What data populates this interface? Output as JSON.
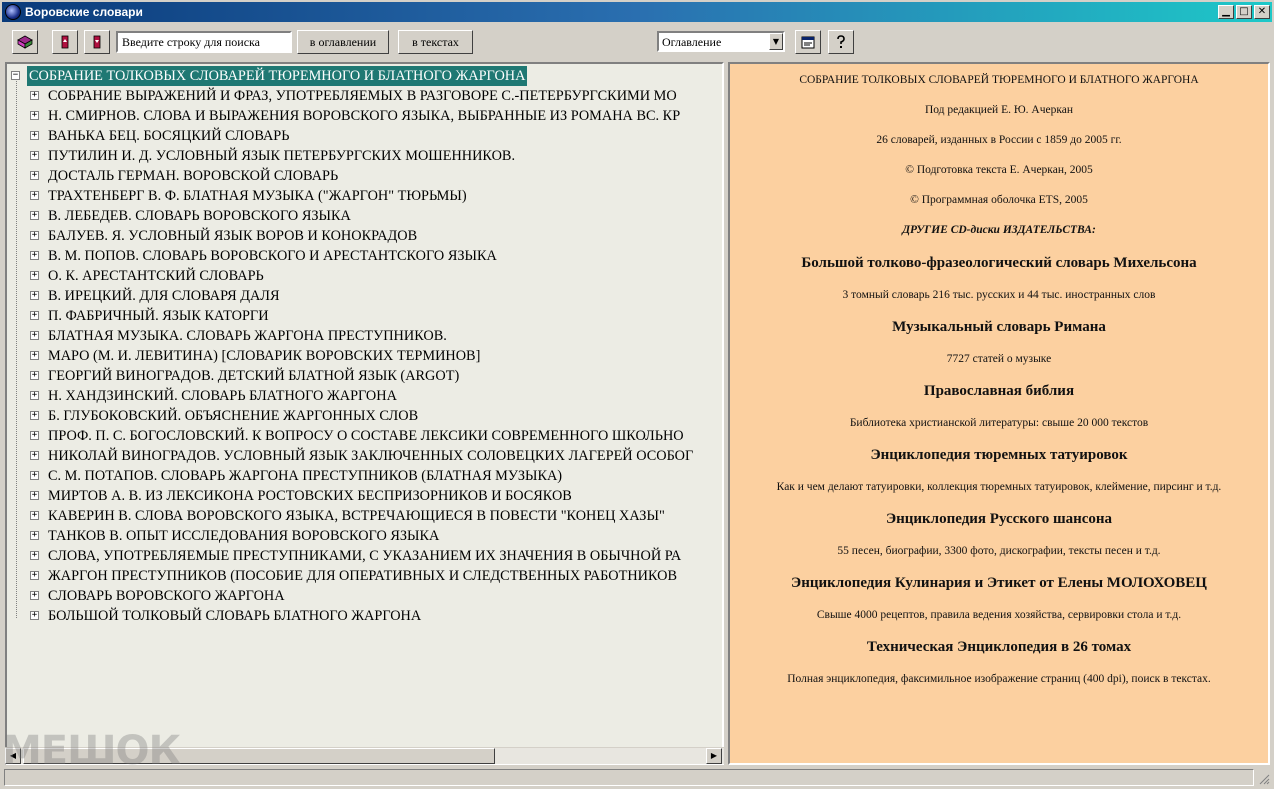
{
  "window": {
    "title": "Воровские словари"
  },
  "toolbar": {
    "search_placeholder": "Введите строку для поиска",
    "btn_in_contents": "в оглавлении",
    "btn_in_texts": "в текстах",
    "select_value": "Оглавление"
  },
  "tree": {
    "root": "СОБРАНИЕ ТОЛКОВЫХ СЛОВАРЕЙ ТЮРЕМНОГО И БЛАТНОГО ЖАРГОНА",
    "items": [
      "СОБРАНИЕ ВЫРАЖЕНИЙ И ФРАЗ, УПОТРЕБЛЯЕМЫХ В РАЗГОВОРЕ С.-ПЕТЕРБУРГСКИМИ МО",
      "Н. СМИРНОВ. СЛОВА И ВЫРАЖЕНИЯ ВОРОВСКОГО ЯЗЫКА, ВЫБРАННЫЕ ИЗ РОМАНА ВС. КР",
      "ВАНЬКА БЕЦ. БОСЯЦКИЙ СЛОВАРЬ",
      "ПУТИЛИН И. Д. УСЛОВНЫЙ ЯЗЫК ПЕТЕРБУРГСКИХ МОШЕННИКОВ.",
      "ДОСТАЛЬ ГЕРМАН. ВОРОВСКОЙ СЛОВАРЬ",
      "ТРАХТЕНБЕРГ В. Ф. БЛАТНАЯ МУЗЫКА (\"ЖАРГОН\" ТЮРЬМЫ)",
      "В. ЛЕБЕДЕВ. СЛОВАРЬ ВОРОВСКОГО ЯЗЫКА",
      "БАЛУЕВ. Я. УСЛОВНЫЙ ЯЗЫК ВОРОВ И КОНОКРАДОВ",
      "В. М. ПОПОВ. СЛОВАРЬ ВОРОВСКОГО И АРЕСТАНТСКОГО ЯЗЫКА",
      "О. К. АРЕСТАНТСКИЙ СЛОВАРЬ",
      "В. ИРЕЦКИЙ. ДЛЯ СЛОВАРЯ ДАЛЯ",
      "П. ФАБРИЧНЫЙ. ЯЗЫК КАТОРГИ",
      "БЛАТНАЯ МУЗЫКА. СЛОВАРЬ ЖАРГОНА ПРЕСТУПНИКОВ.",
      "МАРО (М. И. ЛЕВИТИНА) [СЛОВАРИК ВОРОВСКИХ ТЕРМИНОВ]",
      "ГЕОРГИЙ ВИНОГРАДОВ. ДЕТСКИЙ БЛАТНОЙ ЯЗЫК (ARGOT)",
      "Н. ХАНДЗИНСКИЙ. СЛОВАРЬ БЛАТНОГО ЖАРГОНА",
      "Б. ГЛУБОКОВСКИЙ. ОБЪЯСНЕНИЕ ЖАРГОННЫХ СЛОВ",
      "ПРОФ. П. С. БОГОСЛОВСКИЙ. К ВОПРОСУ О СОСТАВЕ ЛЕКСИКИ СОВРЕМЕННОГО ШКОЛЬНО",
      "НИКОЛАЙ ВИНОГРАДОВ. УСЛОВНЫЙ ЯЗЫК ЗАКЛЮЧЕННЫХ СОЛОВЕЦКИХ ЛАГЕРЕЙ ОСОБОГ",
      "С. М. ПОТАПОВ. СЛОВАРЬ ЖАРГОНА ПРЕСТУПНИКОВ (БЛАТНАЯ МУЗЫКА)",
      "МИРТОВ А. В. ИЗ ЛЕКСИКОНА РОСТОВСКИХ БЕСПРИЗОРНИКОВ И БОСЯКОВ",
      "КАВЕРИН В. СЛОВА ВОРОВСКОГО ЯЗЫКА, ВСТРЕЧАЮЩИЕСЯ В ПОВЕСТИ \"КОНЕЦ ХАЗЫ\"",
      "ТАНКОВ В. ОПЫТ ИССЛЕДОВАНИЯ ВОРОВСКОГО ЯЗЫКА",
      "СЛОВА, УПОТРЕБЛЯЕМЫЕ ПРЕСТУПНИКАМИ, С УКАЗАНИЕМ ИХ ЗНАЧЕНИЯ В ОБЫЧНОЙ РА",
      "ЖАРГОН ПРЕСТУПНИКОВ (ПОСОБИЕ ДЛЯ ОПЕРАТИВНЫХ И СЛЕДСТВЕННЫХ РАБОТНИКОВ",
      "СЛОВАРЬ ВОРОВСКОГО ЖАРГОНА",
      "БОЛЬШОЙ ТОЛКОВЫЙ СЛОВАРЬ БЛАТНОГО ЖАРГОНА"
    ]
  },
  "content": {
    "heading": "СОБРАНИЕ ТОЛКОВЫХ СЛОВАРЕЙ ТЮРЕМНОГО И БЛАТНОГО ЖАРГОНА",
    "editor": "Под редакцией Е. Ю. Ачеркан",
    "summary": "26 словарей, изданных в России с 1859 до 2005 гг.",
    "copyright_text": "© Подготовка текста Е. Ачеркан, 2005",
    "copyright_shell": "© Программная оболочка ETS, 2005",
    "other_cds": "ДРУГИЕ CD-диски ИЗДАТЕЛЬСТВА:",
    "products": [
      {
        "title": "Большой толково-фразеологический словарь Михельсона",
        "desc": "3 томный словарь 216 тыс. русских и 44 тыс. иностранных слов"
      },
      {
        "title": "Музыкальный словарь Римана",
        "desc": "7727 статей о музыке"
      },
      {
        "title": "Православная библия",
        "desc": "Библиотека христианской литературы: свыше 20 000 текстов"
      },
      {
        "title": "Энциклопедия тюремных татуировок",
        "desc": "Как и чем делают татуировки, коллекция тюремных татуировок, клеймение, пирсинг и т.д."
      },
      {
        "title": "Энциклопедия Русского шансона",
        "desc": "55 песен, биографии, 3300 фото, дискографии, тексты песен и т.д."
      },
      {
        "title": "Энциклопедия Кулинария и Этикет от Елены МОЛОХОВЕЦ",
        "desc": "Свыше 4000 рецептов, правила ведения хозяйства, сервировки стола и т.д."
      },
      {
        "title": "Техническая Энциклопедия в 26 томах",
        "desc": "Полная энциклопедия, факсимильное изображение страниц (400 dpi), поиск в текстах."
      }
    ]
  },
  "watermark": "МЕШОК",
  "colors": {
    "content_bg": "#fcd0a0",
    "tree_bg": "#ecece4",
    "selection": "#1f7873"
  }
}
